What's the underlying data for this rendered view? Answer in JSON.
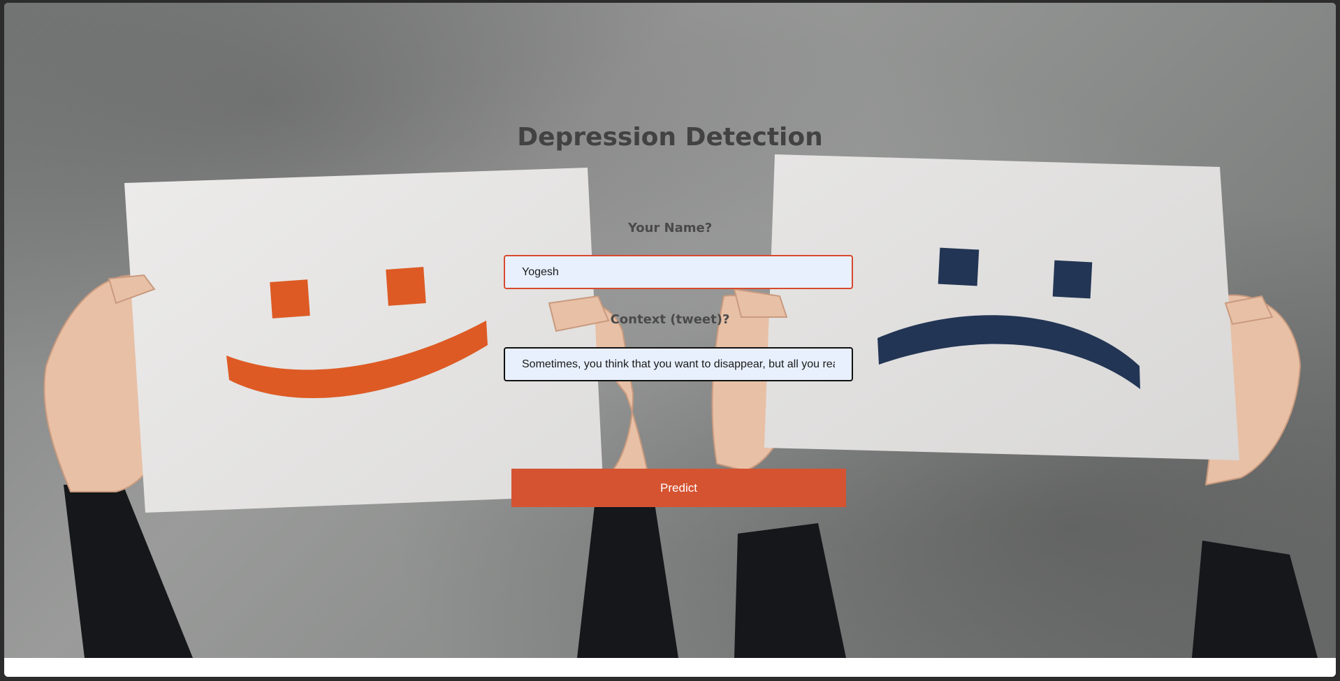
{
  "page": {
    "title": "Depression Detection"
  },
  "form": {
    "name_label": "Your Name?",
    "name_value": "Yogesh",
    "context_label": "Context (tweet)?",
    "context_value": "Sometimes, you think that you want to disappear, but all you really want is to be found.",
    "predict_label": "Predict"
  },
  "theme": {
    "accent": "#d55331",
    "sad_face_color": "#233554",
    "happy_face_color": "#dd5a24",
    "title_color": "#424242"
  },
  "background": {
    "left_sign": "happy-face",
    "right_sign": "sad-face"
  }
}
